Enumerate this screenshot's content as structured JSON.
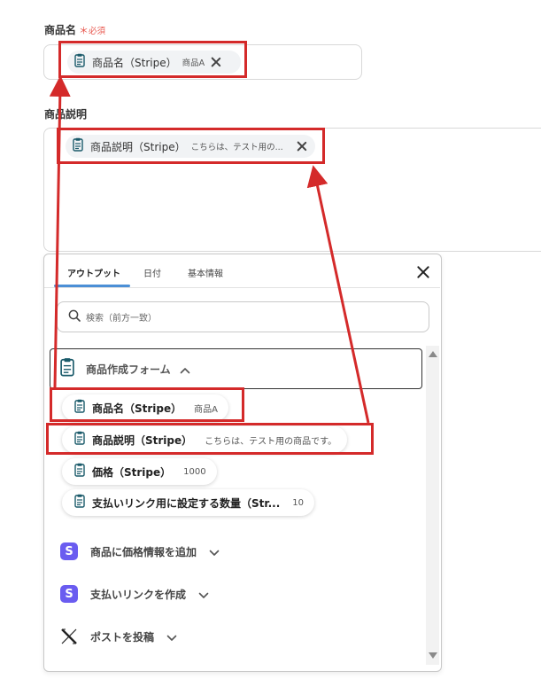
{
  "product_name_field": {
    "label": "商品名",
    "required_star": "＊",
    "required_text": "必須",
    "chip_name": "商品名（Stripe）",
    "chip_value": "商品A"
  },
  "product_description_field": {
    "label": "商品説明",
    "chip_name": "商品説明（Stripe）",
    "chip_value": "こちらは、テスト用の..."
  },
  "panel": {
    "tabs": [
      {
        "label": "アウトプット"
      },
      {
        "label": "日付"
      },
      {
        "label": "基本情報"
      }
    ],
    "search_placeholder": "検索（前方一致）",
    "group": {
      "title": "商品作成フォーム",
      "items": [
        {
          "name": "商品名（Stripe）",
          "value": "商品A"
        },
        {
          "name": "商品説明（Stripe）",
          "value": "こちらは、テスト用の商品です。"
        },
        {
          "name": "価格（Stripe）",
          "value": "1000"
        },
        {
          "name": "支払いリンク用に設定する数量（Str...",
          "value": "10"
        }
      ]
    },
    "services": [
      {
        "label": "商品に価格情報を追加",
        "icon": "stripe-icon"
      },
      {
        "label": "支払いリンクを作成",
        "icon": "stripe-icon"
      },
      {
        "label": "ポストを投稿",
        "icon": "x-logo-icon"
      }
    ],
    "stripe_letter": "S"
  },
  "colors": {
    "highlight_red": "#d42a2a",
    "tab_accent": "#4b8fd6",
    "required_red": "#e8564d",
    "stripe_purple": "#6a5cf0"
  }
}
